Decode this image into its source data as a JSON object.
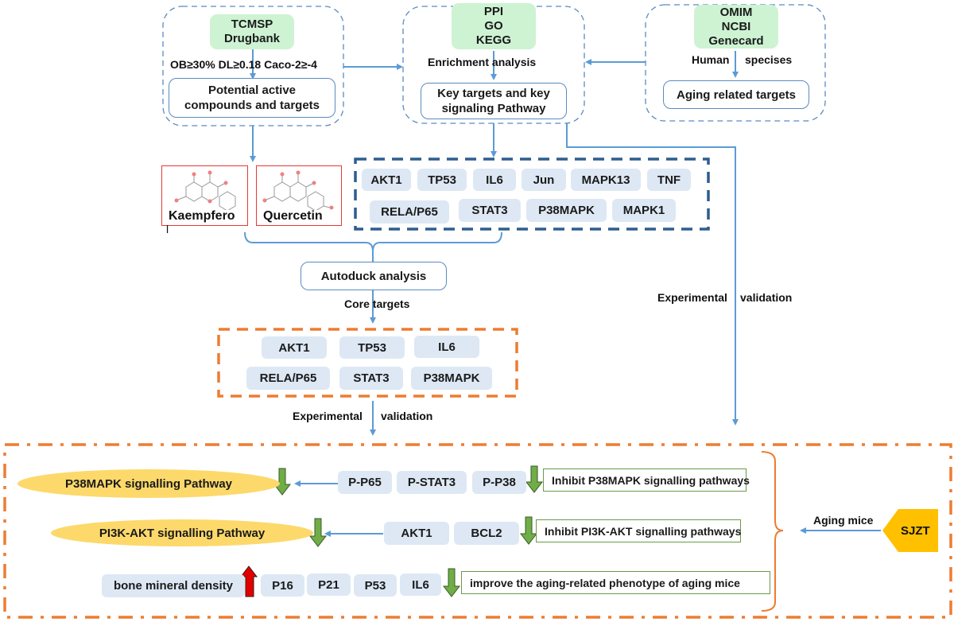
{
  "top_panels": {
    "left": {
      "sources": [
        "TCMSP",
        "Drugbank"
      ],
      "filter_label": "OB≥30%  DL≥0.18 Caco-2≥-4",
      "result": [
        "Potential active",
        "compounds and targets"
      ]
    },
    "middle": {
      "sources": [
        "PPI",
        "GO",
        "KEGG"
      ],
      "filter_label": "Enrichment analysis",
      "result": [
        "Key targets and key",
        "signaling Pathway"
      ]
    },
    "right": {
      "sources": [
        "OMIM",
        "NCBI",
        "Genecard"
      ],
      "filter_left": "Human",
      "filter_right": "specises",
      "result": [
        "Aging related targets"
      ]
    }
  },
  "compounds": [
    {
      "name": "Kaempfero",
      "name_wrap": "l"
    },
    {
      "name": "Quercetin"
    }
  ],
  "key_targets": {
    "row1": [
      "AKT1",
      "TP53",
      "IL6",
      "Jun",
      "MAPK13",
      "TNF"
    ],
    "row2": [
      "RELA/P65",
      "STAT3",
      "P38MAPK",
      "MAPK1"
    ]
  },
  "docking": {
    "label": "Autoduck analysis",
    "edge_label": "Core targets"
  },
  "core_targets": {
    "row1": [
      "AKT1",
      "TP53",
      "IL6"
    ],
    "row2": [
      "RELA/P65",
      "STAT3",
      "P38MAPK"
    ]
  },
  "validation_labels": {
    "left_a": "Experimental",
    "left_b": "validation",
    "right_a": "Experimental",
    "right_b": "validation"
  },
  "results": {
    "row1": {
      "pathway": "P38MAPK signalling Pathway",
      "markers": [
        "P-P65",
        "P-STAT3",
        "P-P38"
      ],
      "marker_direction": "down",
      "conclusion": "Inhibit P38MAPK signalling pathways"
    },
    "row2": {
      "pathway": "PI3K-AKT signalling Pathway",
      "markers": [
        "AKT1",
        "BCL2"
      ],
      "marker_direction": "down",
      "conclusion": "Inhibit PI3K-AKT signalling  pathways"
    },
    "row3": {
      "phenotype": "bone mineral density",
      "phenotype_direction": "up",
      "markers": [
        "P16",
        "P21",
        "P53",
        "IL6"
      ],
      "marker_direction": "down",
      "conclusion": "improve the aging-related phenotype of aging mice"
    }
  },
  "model": {
    "label": "Aging mice",
    "drug": "SJZT"
  },
  "colors": {
    "arrow_blue": "#5b9bd5",
    "dashed_navy": "#2e5d8e",
    "orange": "#ed7d31",
    "chip": "#dde8f4",
    "source_green": "#cdf3d3",
    "pathway_yellow": "#fcd96a",
    "down_green": "#70ad47",
    "up_red": "#e00000",
    "drug_gold": "#ffc000"
  }
}
